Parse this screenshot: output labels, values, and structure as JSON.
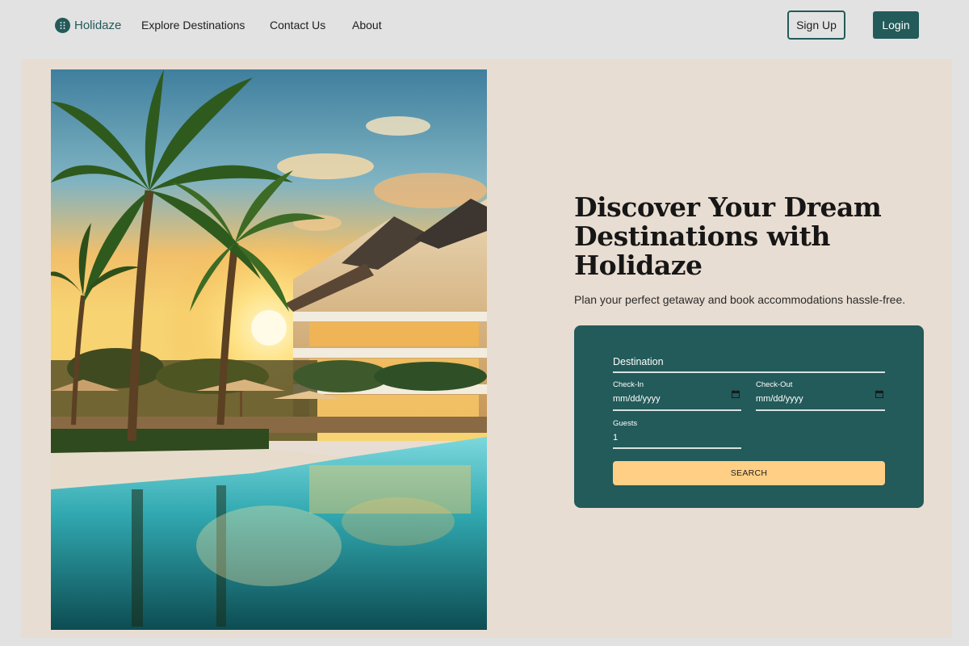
{
  "header": {
    "logo_text": "Holidaze",
    "logo_icon": "grid-dots-icon",
    "nav": [
      "Explore Destinations",
      "Contact Us",
      "About"
    ],
    "signup_label": "Sign Up",
    "login_label": "Login"
  },
  "hero": {
    "image_description": "tropical-resort-pool-palms-sunset",
    "title": "Discover Your Dream Destinations with Holidaze",
    "subtitle": "Plan your perfect getaway and book accommodations hassle-free."
  },
  "search_form": {
    "destination_placeholder": "Destination",
    "checkin_label": "Check-In",
    "checkin_value": "mm/dd/yyyy",
    "checkout_label": "Check-Out",
    "checkout_value": "mm/dd/yyyy",
    "guests_label": "Guests",
    "guests_value": "1",
    "search_label": "SEARCH"
  },
  "colors": {
    "brand": "#235a5a",
    "accent": "#ffcf86",
    "hero_bg": "#e8ddd2",
    "page_bg": "#e2e2e2"
  }
}
